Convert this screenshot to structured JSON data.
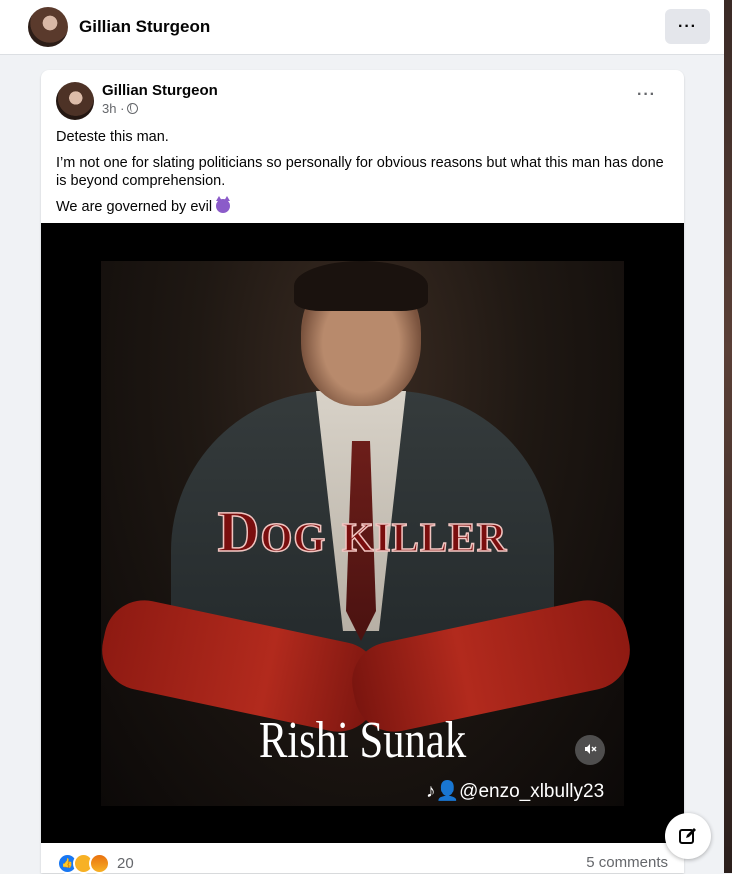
{
  "header": {
    "name": "Gillian Sturgeon",
    "more_label": "···"
  },
  "post": {
    "author": "Gillian Sturgeon",
    "time": "3h ·",
    "more_label": "···",
    "paragraphs": [
      "Deteste this man.",
      "I’m not one for slating politicians so personally for obvious reasons but what this man has done is beyond comprehension.",
      "We are governed by evil"
    ],
    "image": {
      "title_text": "Dog killer",
      "name_text": "Rishi Sunak",
      "watermark": "♪👤@enzo_xlbully23"
    },
    "reactions": {
      "count": "20",
      "types": [
        "like-icon",
        "sad-icon",
        "angry-icon"
      ]
    },
    "comments": "5 comments"
  },
  "icons": {
    "compose": "compose-icon",
    "mute": "mute-icon",
    "globe": "globe-icon",
    "devil": "devil-emoji-icon"
  },
  "colors": {
    "accent": "#1877f2",
    "background": "#f0f2f5"
  }
}
